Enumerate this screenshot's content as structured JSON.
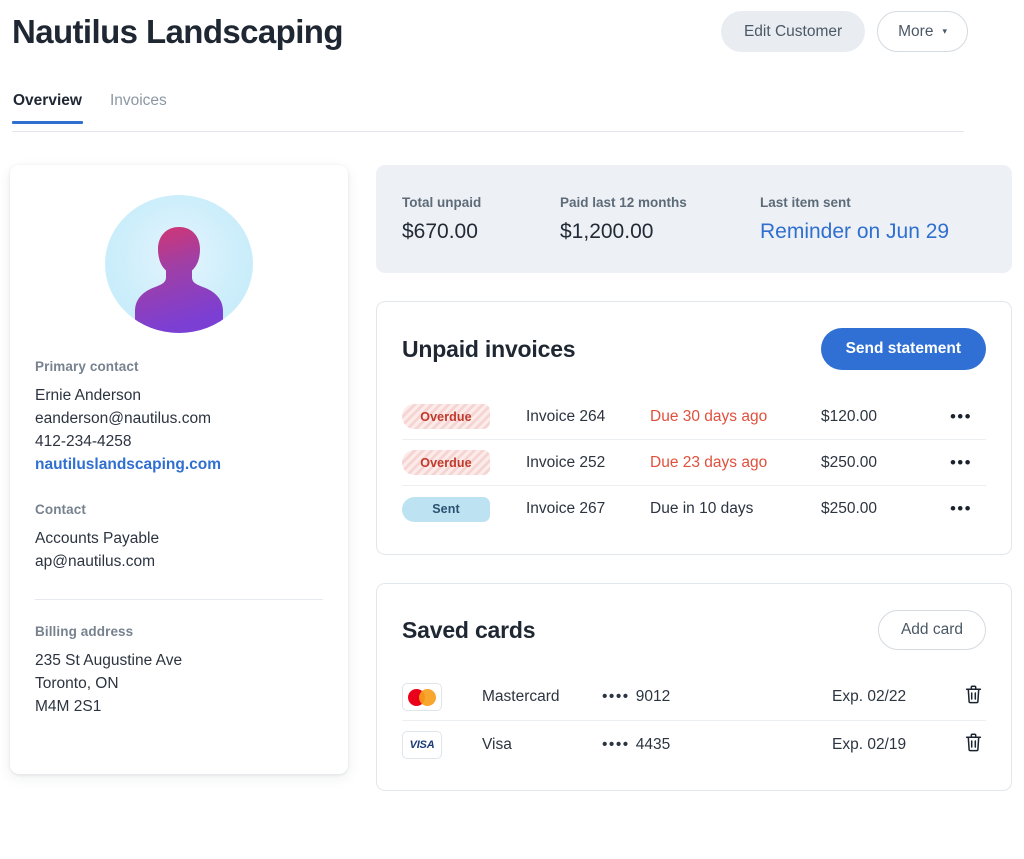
{
  "header": {
    "title": "Nautilus Landscaping",
    "edit_customer_label": "Edit Customer",
    "more_label": "More",
    "more_caret": "▾"
  },
  "tabs": [
    {
      "label": "Overview",
      "active": true
    },
    {
      "label": "Invoices",
      "active": false
    }
  ],
  "profile": {
    "primary_contact_label": "Primary contact",
    "primary_contact_name": "Ernie Anderson",
    "primary_contact_email": "eanderson@nautilus.com",
    "primary_contact_phone": "412-234-4258",
    "website": "nautiluslandscaping.com",
    "contact_label": "Contact",
    "contact_name": "Accounts Payable",
    "contact_email": "ap@nautilus.com",
    "billing_address_label": "Billing address",
    "billing_address_line1": "235 St Augustine Ave",
    "billing_address_line2": "Toronto, ON",
    "billing_address_line3": "M4M 2S1"
  },
  "stats": [
    {
      "label": "Total unpaid",
      "value": "$670.00",
      "is_link": false
    },
    {
      "label": "Paid last 12 months",
      "value": "$1,200.00",
      "is_link": false
    },
    {
      "label": "Last item sent",
      "value": "Reminder on Jun 29",
      "is_link": true
    }
  ],
  "unpaid_invoices": {
    "title": "Unpaid invoices",
    "send_statement_label": "Send statement",
    "kebab_glyph": "•••",
    "rows": [
      {
        "status": "Overdue",
        "status_kind": "overdue",
        "invoice": "Invoice 264",
        "due": "Due 30 days ago",
        "due_kind": "overdue",
        "amount": "$120.00"
      },
      {
        "status": "Overdue",
        "status_kind": "overdue",
        "invoice": "Invoice 252",
        "due": "Due 23 days ago",
        "due_kind": "overdue",
        "amount": "$250.00"
      },
      {
        "status": "Sent",
        "status_kind": "sent",
        "invoice": "Invoice 267",
        "due": "Due in 10 days",
        "due_kind": "normal",
        "amount": "$250.00"
      }
    ]
  },
  "saved_cards": {
    "title": "Saved cards",
    "add_card_label": "Add card",
    "mask_dots": "••••",
    "rows": [
      {
        "brand": "Mastercard",
        "brand_icon": "mastercard-logo",
        "last4": "9012",
        "exp": "Exp. 02/22",
        "delete_icon": "trash-icon"
      },
      {
        "brand": "Visa",
        "brand_icon": "visa-logo",
        "last4": "4435",
        "exp": "Exp. 02/19",
        "delete_icon": "trash-icon"
      }
    ]
  },
  "colors": {
    "accent_blue": "#3070d4",
    "link_blue": "#2f6fd0",
    "overdue_red": "#e0503c",
    "badge_overdue_bg": "#f6d4d2",
    "badge_sent_bg": "#bde3f2",
    "stats_bg": "#edf1f5"
  }
}
